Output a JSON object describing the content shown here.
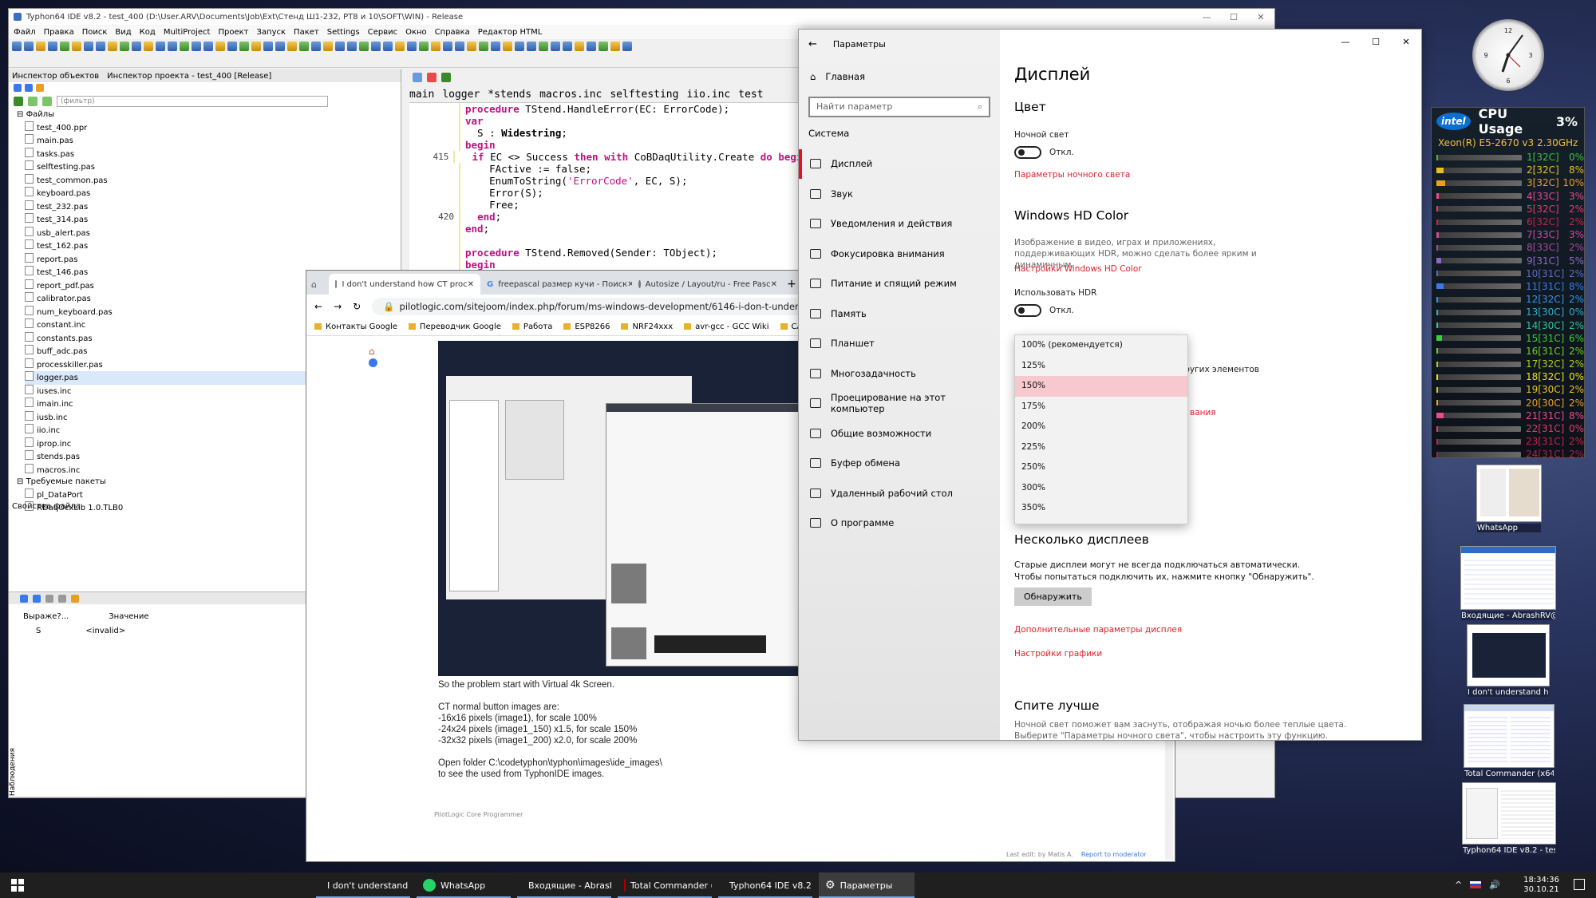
{
  "ide": {
    "title": "Typhon64 IDE v8.2 - test_400 (D:\\User.ARV\\Documents\\Job\\Ext\\Стенд Ш1-232, РТ8 и 10\\SOFT\\WIN) - Release",
    "menu": [
      "Файл",
      "Правка",
      "Поиск",
      "Вид",
      "Код",
      "MultiProject",
      "Проект",
      "Запуск",
      "Пакет",
      "Settings",
      "Сервис",
      "Окно",
      "Справка",
      "Редактор HTML"
    ],
    "left_tabs": [
      "Инспектор объектов",
      "Инспектор проекта - test_400 [Release]"
    ],
    "filter_placeholder": "(фильтр)",
    "tree_root": "Файлы",
    "files": [
      "test_400.ppr",
      "main.pas",
      "tasks.pas",
      "selftesting.pas",
      "test_common.pas",
      "keyboard.pas",
      "test_232.pas",
      "test_314.pas",
      "usb_alert.pas",
      "test_162.pas",
      "report.pas",
      "test_146.pas",
      "report_pdf.pas",
      "calibrator.pas",
      "num_keyboard.pas",
      "constant.inc",
      "constants.pas",
      "buff_adc.pas",
      "processkiller.pas",
      "logger.pas",
      "iuses.inc",
      "imain.inc",
      "iusb.inc",
      "iio.inc",
      "iprop.inc",
      "stends.pas",
      "macros.inc"
    ],
    "packages_label": "Требуемые пакеты",
    "packages": [
      "pl_DataPort",
      "RDaqOcxLib 1.0.TLB0"
    ],
    "file_props": "Свойства файла",
    "watch_cols": [
      "Выраже?...",
      "Значение"
    ],
    "watch_row": [
      "S",
      "<invalid>"
    ],
    "watch_side": "Наблюдения",
    "editor_tabs": [
      "main",
      "logger",
      "*stends",
      "macros.inc",
      "selftesting",
      "iio.inc",
      "test"
    ],
    "code": [
      {
        "n": "",
        "t": "procedure TStend.HandleError(EC: ErrorCode);"
      },
      {
        "n": "",
        "t": "var"
      },
      {
        "n": "",
        "t": "  S : Widestring;"
      },
      {
        "n": "",
        "t": "begin"
      },
      {
        "n": "415",
        "t": "  if EC <> Success then with CoBDaqUtility.Create do begin"
      },
      {
        "n": "",
        "t": "    FActive := false;"
      },
      {
        "n": "",
        "t": "    EnumToString('ErrorCode', EC, S);"
      },
      {
        "n": "",
        "t": "    Error(S);"
      },
      {
        "n": "",
        "t": "    Free;"
      },
      {
        "n": "420",
        "t": "  end;"
      },
      {
        "n": "",
        "t": "end;"
      },
      {
        "n": "",
        "t": ""
      },
      {
        "n": "",
        "t": "procedure TStend.Removed(Sender: TObject);"
      },
      {
        "n": "",
        "t": "begin"
      },
      {
        "n": "425",
        "t": "  FActive := False;"
      }
    ]
  },
  "browser": {
    "tabs": [
      "I don't understand how CT proc",
      "freepascal размер кучи - Поиск",
      "Autosize / Layout/ru - Free Pasc"
    ],
    "url": "pilotlogic.com/sitejoom/index.php/forum/ms-windows-development/6146-i-don-t-understand-how-ct-p",
    "bookmarks": [
      "Контакты Google",
      "Переводчик Google",
      "Работа",
      "ESP8266",
      "NRF24xxx",
      "avr-gcc - GCC Wiki",
      "САЙТЫ"
    ],
    "post": [
      "So the problem start with Virtual 4k Screen.",
      "",
      "CT normal button images are:",
      "-16x16 pixels (image1), for scale 100%",
      "-24x24 pixels (image1_150) x1.5, for scale 150%",
      "-32x32 pixels (image1_200) x2.0, for scale 200%",
      "",
      "Open folder C:\\codetyphon\\typhon\\images\\ide_images\\",
      "to see the used from TyphonIDE images."
    ],
    "signature": "PilotLogic Core Programmer",
    "last_edit": "Last edit: by Matis A.",
    "report": "Report to moderator"
  },
  "settings": {
    "window_title": "Параметры",
    "home": "Главная",
    "search_placeholder": "Найти параметр",
    "section": "Система",
    "nav": [
      "Дисплей",
      "Звук",
      "Уведомления и действия",
      "Фокусировка внимания",
      "Питание и спящий режим",
      "Память",
      "Планшет",
      "Многозадачность",
      "Проецирование на этот компьютер",
      "Общие возможности",
      "Буфер обмена",
      "Удаленный рабочий стол",
      "О программе"
    ],
    "page_title": "Дисплей",
    "color_h": "Цвет",
    "night_light": "Ночной свет",
    "off": "Откл.",
    "night_link": "Параметры ночного света",
    "hd_h": "Windows HD Color",
    "hd_desc": "Изображение в видео, играх и приложениях, поддерживающих HDR, можно сделать более ярким и динамичным.",
    "hd_link": "Настройки Windows HD Color",
    "hdr_label": "Использовать HDR",
    "scale_options": [
      "100% (рекомендуется)",
      "125%",
      "150%",
      "175%",
      "200%",
      "225%",
      "250%",
      "300%",
      "350%"
    ],
    "scale_selected": "150%",
    "behind_text": "других элементов",
    "behind_link": "вания",
    "multi_h": "Несколько дисплеев",
    "multi_desc1": "Старые дисплеи могут не всегда подключаться автоматически.",
    "multi_desc2": "Чтобы попытаться подключить их, нажмите кнопку \"Обнаружить\".",
    "detect": "Обнаружить",
    "adv_link": "Дополнительные параметры дисплея",
    "gfx_link": "Настройки графики",
    "sleep_h": "Спите лучше",
    "sleep_desc": "Ночной свет поможет вам заснуть, отображая ночью более теплые цвета. Выберите \"Параметры ночного света\", чтобы настроить эту функцию."
  },
  "cpu": {
    "brand": "intel",
    "title": "CPU Usage",
    "total": "3%",
    "model": "Xeon(R) E5-2670 v3 2.30GHz",
    "cores": [
      {
        "l": "1[32C]",
        "p": "0%",
        "c": "#3cc43c"
      },
      {
        "l": "2[32C]",
        "p": "8%",
        "c": "#e8c020"
      },
      {
        "l": "3[32C]",
        "p": "10%",
        "c": "#e8a020"
      },
      {
        "l": "4[33C]",
        "p": "3%",
        "c": "#e84a8a"
      },
      {
        "l": "5[32C]",
        "p": "2%",
        "c": "#e83a6a"
      },
      {
        "l": "6[32C]",
        "p": "2%",
        "c": "#c8204a"
      },
      {
        "l": "7[33C]",
        "p": "3%",
        "c": "#c84a9a"
      },
      {
        "l": "8[33C]",
        "p": "2%",
        "c": "#a84a9a"
      },
      {
        "l": "9[31C]",
        "p": "5%",
        "c": "#8a6ac8"
      },
      {
        "l": "10[31C]",
        "p": "2%",
        "c": "#5a6ac8"
      },
      {
        "l": "11[31C]",
        "p": "8%",
        "c": "#3a7ae8"
      },
      {
        "l": "12[32C]",
        "p": "2%",
        "c": "#2a9ae8"
      },
      {
        "l": "13[30C]",
        "p": "0%",
        "c": "#2ab0c8"
      },
      {
        "l": "14[30C]",
        "p": "2%",
        "c": "#2ac89a"
      },
      {
        "l": "15[31C]",
        "p": "6%",
        "c": "#3ad03a"
      },
      {
        "l": "16[31C]",
        "p": "2%",
        "c": "#6ad02a"
      },
      {
        "l": "17[32C]",
        "p": "2%",
        "c": "#a8d020"
      },
      {
        "l": "18[32C]",
        "p": "0%",
        "c": "#e8e020"
      },
      {
        "l": "19[30C]",
        "p": "2%",
        "c": "#e8c020"
      },
      {
        "l": "20[30C]",
        "p": "2%",
        "c": "#e8a020"
      },
      {
        "l": "21[31C]",
        "p": "8%",
        "c": "#e84a8a"
      },
      {
        "l": "22[31C]",
        "p": "0%",
        "c": "#e83a6a"
      },
      {
        "l": "23[31C]",
        "p": "2%",
        "c": "#c8204a"
      },
      {
        "l": "24[31C]",
        "p": "2%",
        "c": "#a8204a"
      }
    ]
  },
  "thumbs": [
    "WhatsApp",
    "Входящие - AbrashRV@...",
    "I don't understand h...",
    "Total Commander (x64...",
    "Typhon64 IDE v8.2 - tes..."
  ],
  "taskbar": {
    "items": [
      "I don't understand ...",
      "WhatsApp",
      "Входящие - Abrash...",
      "Total Commander (...",
      "Typhon64 IDE v8.2 ...",
      "Параметры"
    ],
    "time": "18:34:36",
    "date": "30.10.21"
  }
}
